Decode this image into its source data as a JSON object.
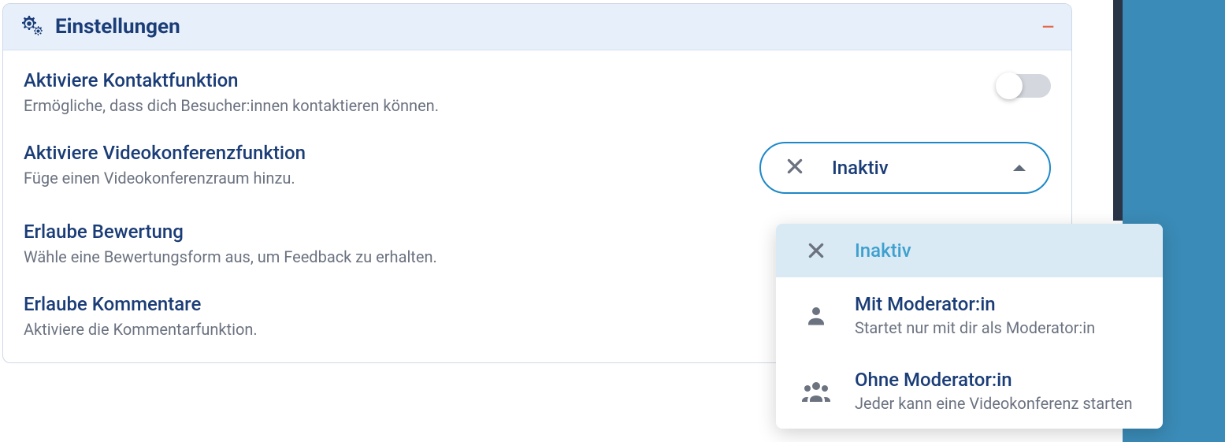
{
  "panel": {
    "title": "Einstellungen"
  },
  "settings": {
    "contact": {
      "title": "Aktiviere Kontaktfunktion",
      "desc": "Ermögliche, dass dich Besucher:innen kontaktieren können."
    },
    "video": {
      "title": "Aktiviere Videokonferenzfunktion",
      "desc": "Füge einen Videokonferenzraum hinzu.",
      "selected": "Inaktiv"
    },
    "rating": {
      "title": "Erlaube Bewertung",
      "desc": "Wähle eine Bewertungsform aus, um Feedback zu erhalten."
    },
    "comments": {
      "title": "Erlaube Kommentare",
      "desc": "Aktiviere die Kommentarfunktion."
    }
  },
  "dropdown": {
    "options": [
      {
        "title": "Inaktiv",
        "sub": ""
      },
      {
        "title": "Mit Moderator:in",
        "sub": "Startet nur mit dir als Moderator:in"
      },
      {
        "title": "Ohne Moderator:in",
        "sub": "Jeder kann eine Videokonferenz starten"
      }
    ]
  }
}
